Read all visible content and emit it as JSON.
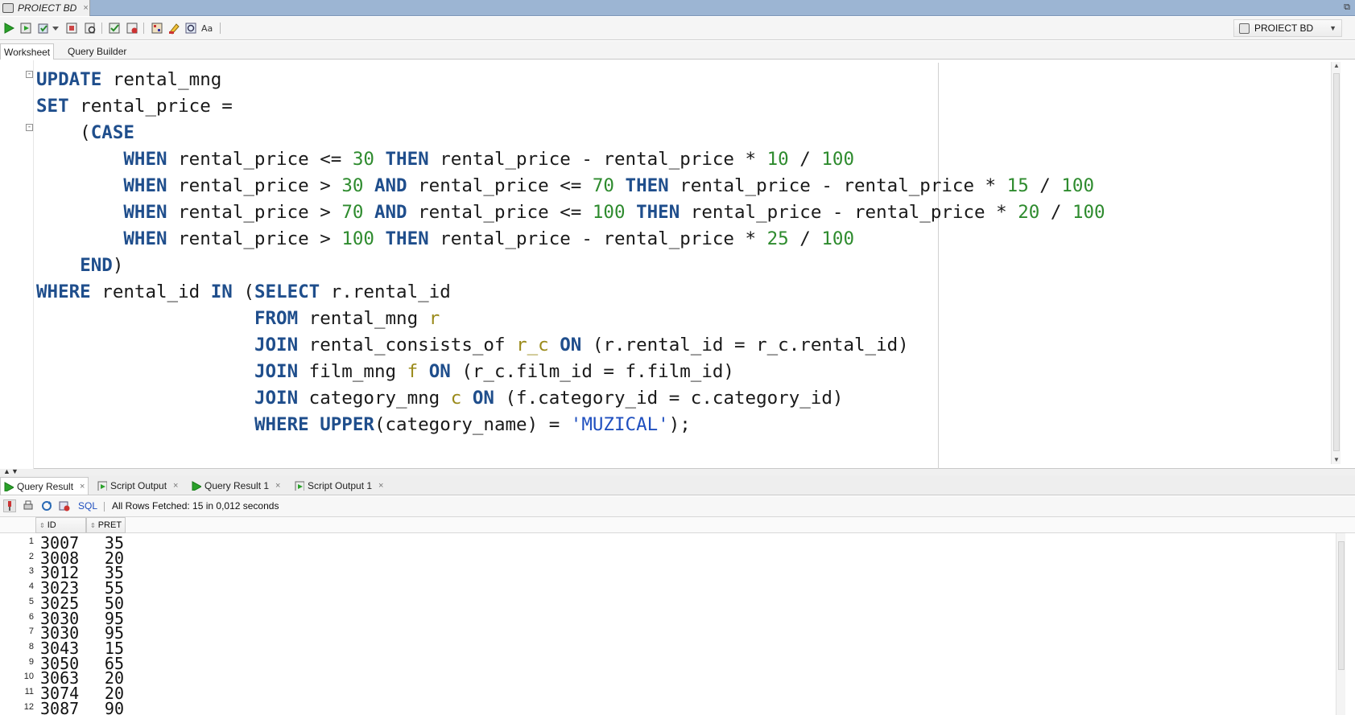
{
  "document_tab": {
    "title": "PROIECT BD",
    "close": "×"
  },
  "toolbar": {
    "icons": [
      "run-statement-icon",
      "run-script-icon",
      "commit-icon",
      "rollback-icon",
      "autotrace-icon",
      "explain-plan-icon",
      "sql-tuning-icon",
      "clear-icon",
      "history-icon",
      "unshared-worksheet-icon",
      "format-icon"
    ],
    "connection": "PROIECT BD"
  },
  "subtabs": {
    "worksheet": "Worksheet",
    "query_builder": "Query Builder"
  },
  "editor": {
    "lines": [
      [
        [
          "kw",
          "UPDATE"
        ],
        [
          "t",
          " rental_mng"
        ]
      ],
      [
        [
          "kw",
          "SET"
        ],
        [
          "t",
          " rental_price ="
        ]
      ],
      [
        [
          "t",
          "    ("
        ],
        [
          "kw",
          "CASE"
        ]
      ],
      [
        [
          "t",
          "        "
        ],
        [
          "kw",
          "WHEN"
        ],
        [
          "t",
          " rental_price <= "
        ],
        [
          "num",
          "30"
        ],
        [
          "t",
          " "
        ],
        [
          "kw",
          "THEN"
        ],
        [
          "t",
          " rental_price - rental_price * "
        ],
        [
          "num",
          "10"
        ],
        [
          "t",
          " / "
        ],
        [
          "num",
          "100"
        ]
      ],
      [
        [
          "t",
          "        "
        ],
        [
          "kw",
          "WHEN"
        ],
        [
          "t",
          " rental_price > "
        ],
        [
          "num",
          "30"
        ],
        [
          "t",
          " "
        ],
        [
          "kw",
          "AND"
        ],
        [
          "t",
          " rental_price <= "
        ],
        [
          "num",
          "70"
        ],
        [
          "t",
          " "
        ],
        [
          "kw",
          "THEN"
        ],
        [
          "t",
          " rental_price - rental_price * "
        ],
        [
          "num",
          "15"
        ],
        [
          "t",
          " / "
        ],
        [
          "num",
          "100"
        ]
      ],
      [
        [
          "t",
          "        "
        ],
        [
          "kw",
          "WHEN"
        ],
        [
          "t",
          " rental_price > "
        ],
        [
          "num",
          "70"
        ],
        [
          "t",
          " "
        ],
        [
          "kw",
          "AND"
        ],
        [
          "t",
          " rental_price <= "
        ],
        [
          "num",
          "100"
        ],
        [
          "t",
          " "
        ],
        [
          "kw",
          "THEN"
        ],
        [
          "t",
          " rental_price - rental_price * "
        ],
        [
          "num",
          "20"
        ],
        [
          "t",
          " / "
        ],
        [
          "num",
          "100"
        ]
      ],
      [
        [
          "t",
          "        "
        ],
        [
          "kw",
          "WHEN"
        ],
        [
          "t",
          " rental_price > "
        ],
        [
          "num",
          "100"
        ],
        [
          "t",
          " "
        ],
        [
          "kw",
          "THEN"
        ],
        [
          "t",
          " rental_price - rental_price * "
        ],
        [
          "num",
          "25"
        ],
        [
          "t",
          " / "
        ],
        [
          "num",
          "100"
        ]
      ],
      [
        [
          "t",
          "    "
        ],
        [
          "kw",
          "END"
        ],
        [
          "t",
          ")"
        ]
      ],
      [
        [
          "kw",
          "WHERE"
        ],
        [
          "t",
          " rental_id "
        ],
        [
          "kw",
          "IN"
        ],
        [
          "t",
          " ("
        ],
        [
          "kw",
          "SELECT"
        ],
        [
          "t",
          " r.rental_id"
        ]
      ],
      [
        [
          "t",
          "                    "
        ],
        [
          "kw",
          "FROM"
        ],
        [
          "t",
          " rental_mng "
        ],
        [
          "alias",
          "r"
        ]
      ],
      [
        [
          "t",
          "                    "
        ],
        [
          "kw",
          "JOIN"
        ],
        [
          "t",
          " rental_consists_of "
        ],
        [
          "alias",
          "r_c"
        ],
        [
          "t",
          " "
        ],
        [
          "kw",
          "ON"
        ],
        [
          "t",
          " (r.rental_id = r_c.rental_id)"
        ]
      ],
      [
        [
          "t",
          "                    "
        ],
        [
          "kw",
          "JOIN"
        ],
        [
          "t",
          " film_mng "
        ],
        [
          "alias",
          "f"
        ],
        [
          "t",
          " "
        ],
        [
          "kw",
          "ON"
        ],
        [
          "t",
          " (r_c.film_id = f.film_id)"
        ]
      ],
      [
        [
          "t",
          "                    "
        ],
        [
          "kw",
          "JOIN"
        ],
        [
          "t",
          " category_mng "
        ],
        [
          "alias",
          "c"
        ],
        [
          "t",
          " "
        ],
        [
          "kw",
          "ON"
        ],
        [
          "t",
          " (f.category_id = c.category_id)"
        ]
      ],
      [
        [
          "t",
          "                    "
        ],
        [
          "kw",
          "WHERE"
        ],
        [
          "t",
          " "
        ],
        [
          "kw",
          "UPPER"
        ],
        [
          "t",
          "(category_name) = "
        ],
        [
          "str",
          "'MUZICAL'"
        ],
        [
          "t",
          ");"
        ]
      ]
    ]
  },
  "results": {
    "tabs": [
      {
        "label": "Query Result",
        "close": "×",
        "icon": "run-icon",
        "active": true
      },
      {
        "label": "Script Output",
        "close": "×",
        "icon": "script-icon",
        "active": false
      },
      {
        "label": "Query Result 1",
        "close": "×",
        "icon": "run-icon",
        "active": false
      },
      {
        "label": "Script Output 1",
        "close": "×",
        "icon": "script-icon",
        "active": false
      }
    ],
    "toolbar": {
      "sql_label": "SQL",
      "status": "All Rows Fetched: 15 in 0,012 seconds"
    },
    "columns": [
      "ID",
      "PRET"
    ],
    "rows": [
      {
        "n": "1",
        "id": "3007",
        "pret": "35"
      },
      {
        "n": "2",
        "id": "3008",
        "pret": "20"
      },
      {
        "n": "3",
        "id": "3012",
        "pret": "35"
      },
      {
        "n": "4",
        "id": "3023",
        "pret": "55"
      },
      {
        "n": "5",
        "id": "3025",
        "pret": "50"
      },
      {
        "n": "6",
        "id": "3030",
        "pret": "95"
      },
      {
        "n": "7",
        "id": "3030",
        "pret": "95"
      },
      {
        "n": "8",
        "id": "3043",
        "pret": "15"
      },
      {
        "n": "9",
        "id": "3050",
        "pret": "65"
      },
      {
        "n": "10",
        "id": "3063",
        "pret": "20"
      },
      {
        "n": "11",
        "id": "3074",
        "pret": "20"
      },
      {
        "n": "12",
        "id": "3087",
        "pret": "90"
      }
    ]
  },
  "colors": {
    "keyword": "#1f4e8c",
    "number": "#2e8b2e",
    "string": "#1f4fbf",
    "alias": "#9a8a1a",
    "tab_strip": "#9cb5d3"
  }
}
